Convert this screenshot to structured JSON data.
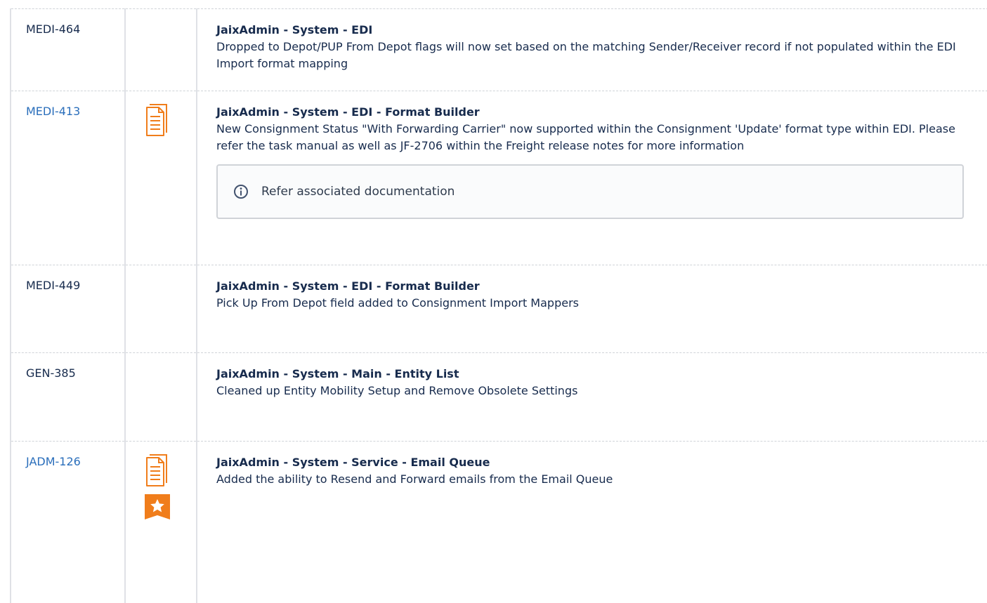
{
  "colors": {
    "link": "#2a6ebb",
    "accent_icon": "#f07d1b",
    "border": "#dfe1e6"
  },
  "rows": [
    {
      "id": "MEDI-464",
      "id_link": false,
      "icons": [],
      "title": "JaixAdmin - System - EDI",
      "description": "Dropped to Depot/PUP From Depot flags will now set based on the matching Sender/Receiver record if not populated within the EDI Import format mapping"
    },
    {
      "id": "MEDI-413",
      "id_link": true,
      "icons": [
        "document-icon"
      ],
      "title": "JaixAdmin - System - EDI - Format Builder",
      "description": "New Consignment Status \"With Forwarding Carrier\" now supported within the Consignment 'Update' format type within EDI.  Please refer the task manual as well as JF-2706 within the Freight release notes for more information",
      "note": {
        "icon": "info-icon",
        "text": "Refer associated documentation"
      }
    },
    {
      "id": "MEDI-449",
      "id_link": false,
      "icons": [],
      "title": "JaixAdmin - System - EDI - Format Builder",
      "description": "Pick Up From Depot field added to Consignment Import Mappers"
    },
    {
      "id": "GEN-385",
      "id_link": false,
      "icons": [],
      "title": "JaixAdmin - System - Main - Entity List",
      "description": "Cleaned up Entity Mobility Setup and Remove Obsolete Settings"
    },
    {
      "id": "JADM-126",
      "id_link": true,
      "icons": [
        "document-icon",
        "star-icon"
      ],
      "title": "JaixAdmin - System - Service - Email Queue",
      "description": "Added the ability to Resend and Forward emails from the Email Queue"
    }
  ]
}
